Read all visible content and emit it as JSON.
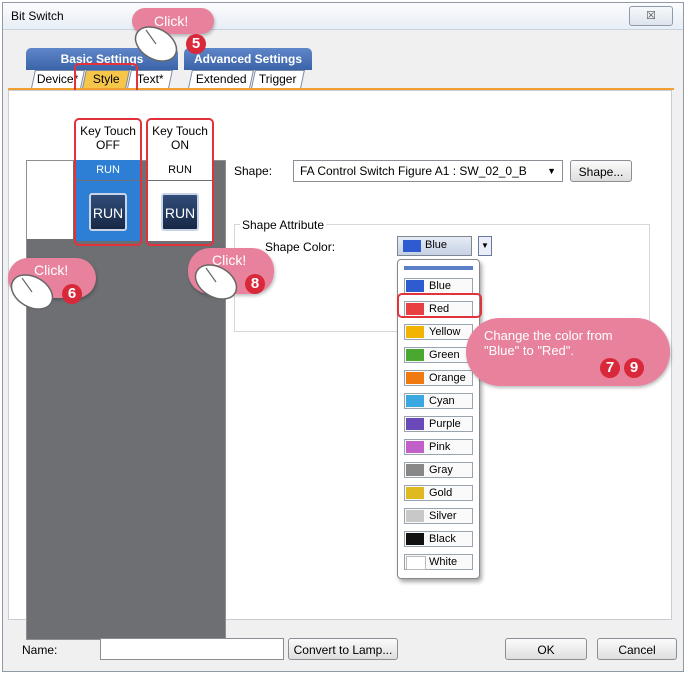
{
  "window": {
    "title": "Bit Switch",
    "close_glyph": "☒"
  },
  "tabs": {
    "groups": [
      "Basic Settings",
      "Advanced Settings"
    ],
    "sub": [
      "Device*",
      "Style",
      "Text*",
      "Extended",
      "Trigger"
    ]
  },
  "preview": {
    "off_header": "Key Touch\nOFF",
    "on_header": "Key Touch\nON",
    "off_header_l1": "Key Touch",
    "off_header_l2": "OFF",
    "on_header_l1": "Key Touch",
    "on_header_l2": "ON",
    "run_label_off": "RUN",
    "run_label_on": "RUN",
    "run_button_off": "RUN",
    "run_button_on": "RUN"
  },
  "shape": {
    "label": "Shape:",
    "value": "FA Control Switch Figure A1 : SW_02_0_B",
    "button": "Shape..."
  },
  "attribute": {
    "group_label": "Shape Attribute",
    "color_label": "Shape Color:",
    "selected": "Blue",
    "options": [
      {
        "label": "Blue",
        "color": "#2f5bd0"
      },
      {
        "label": "Red",
        "color": "#e84040"
      },
      {
        "label": "Yellow",
        "color": "#f2b400"
      },
      {
        "label": "Green",
        "color": "#4aa830"
      },
      {
        "label": "Orange",
        "color": "#f07a10"
      },
      {
        "label": "Cyan",
        "color": "#3aa8e0"
      },
      {
        "label": "Purple",
        "color": "#6a4ab8"
      },
      {
        "label": "Pink",
        "color": "#c060c8"
      },
      {
        "label": "Gray",
        "color": "#888888"
      },
      {
        "label": "Gold",
        "color": "#e0b820"
      },
      {
        "label": "Silver",
        "color": "#c8c8c8"
      },
      {
        "label": "Black",
        "color": "#111111"
      },
      {
        "label": "White",
        "color": "#ffffff"
      }
    ]
  },
  "bottom": {
    "name_label": "Name:",
    "name_value": "",
    "convert_button": "Convert to Lamp...",
    "ok": "OK",
    "cancel": "Cancel"
  },
  "annotations": {
    "click_5": "Click!",
    "num_5": "5",
    "click_6": "Click!",
    "num_6": "6",
    "click_8": "Click!",
    "num_8": "8",
    "change_l1": "Change the color from",
    "change_l2": "\"Blue\" to \"Red\".",
    "num_7": "7",
    "num_9": "9"
  },
  "colors": {
    "accent_tab": "#f6c64a",
    "highlight": "#e2333c",
    "callout": "#e8829c",
    "number": "#d8283a"
  }
}
